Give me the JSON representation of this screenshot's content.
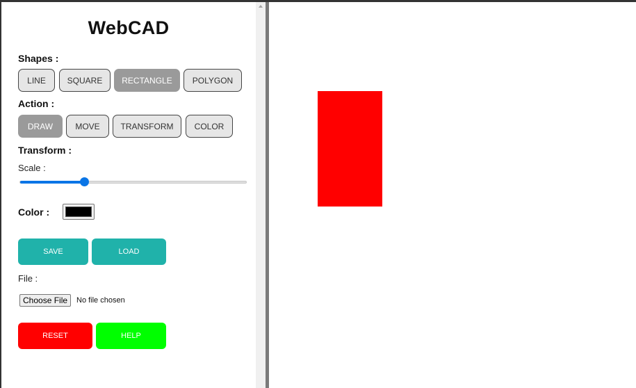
{
  "app": {
    "title": "WebCAD"
  },
  "shapes": {
    "label": "Shapes :",
    "buttons": [
      {
        "label": "LINE",
        "active": false
      },
      {
        "label": "SQUARE",
        "active": false
      },
      {
        "label": "RECTANGLE",
        "active": true
      },
      {
        "label": "POLYGON",
        "active": false
      }
    ]
  },
  "action": {
    "label": "Action :",
    "buttons": [
      {
        "label": "DRAW",
        "active": true
      },
      {
        "label": "MOVE",
        "active": false
      },
      {
        "label": "TRANSFORM",
        "active": false
      },
      {
        "label": "COLOR",
        "active": false
      }
    ]
  },
  "transform": {
    "label": "Transform :",
    "scale_label": "Scale :",
    "scale_fraction": 0.28
  },
  "color": {
    "label": "Color :",
    "value": "#000000"
  },
  "file_actions": {
    "save_label": "SAVE",
    "load_label": "LOAD",
    "save_color": "#20b2aa",
    "load_color": "#20b2aa"
  },
  "file": {
    "label": "File :",
    "choose_label": "Choose File",
    "status": "No file chosen"
  },
  "controls": {
    "reset_label": "RESET",
    "help_label": "HELP",
    "reset_color": "#ff0000",
    "help_color": "#00ff00"
  },
  "canvas": {
    "shape_type": "rectangle",
    "shape_color": "#ff0000"
  }
}
